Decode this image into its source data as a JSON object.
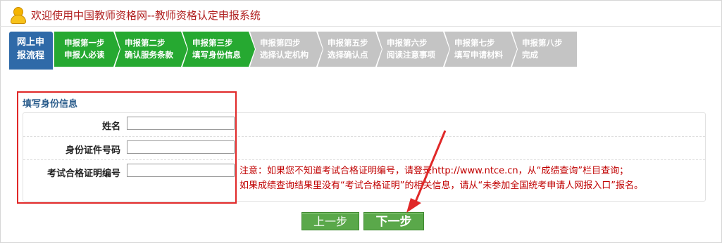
{
  "header": {
    "title": "欢迎使用中国教师资格网--教师资格认定申报系统"
  },
  "steps": {
    "start": {
      "line1": "网上申",
      "line2": "报流程"
    },
    "items": [
      {
        "line1": "申报第一步",
        "line2": "申报人必读",
        "status": "done"
      },
      {
        "line1": "申报第二步",
        "line2": "确认服务条款",
        "status": "done"
      },
      {
        "line1": "申报第三步",
        "line2": "填写身份信息",
        "status": "done"
      },
      {
        "line1": "申报第四步",
        "line2": "选择认定机构",
        "status": "todo"
      },
      {
        "line1": "申报第五步",
        "line2": "选择确认点",
        "status": "todo"
      },
      {
        "line1": "申报第六步",
        "line2": "阅读注意事项",
        "status": "todo"
      },
      {
        "line1": "申报第七步",
        "line2": "填写申请材料",
        "status": "todo"
      },
      {
        "line1": "申报第八步",
        "line2": "完成",
        "status": "todo"
      }
    ]
  },
  "form": {
    "section_title": "填写身份信息",
    "fields": [
      {
        "label": "姓名",
        "value": ""
      },
      {
        "label": "身份证件号码",
        "value": ""
      },
      {
        "label": "考试合格证明编号",
        "value": ""
      }
    ],
    "note_line1": "注意：如果您不知道考试合格证明编号，请登录http://www.ntce.cn，从“成绩查询”栏目查询；",
    "note_line2": "如果成绩查询结果里没有“考试合格证明”的相关信息，请从“未参加全国统考申请人网报入口”报名。"
  },
  "buttons": {
    "prev": "上一步",
    "next": "下一步"
  },
  "colors": {
    "done": "#26a931",
    "todo": "#c4c4c4",
    "start": "#2f6aa8",
    "annotation": "#e02828",
    "title": "#b01e1e"
  }
}
